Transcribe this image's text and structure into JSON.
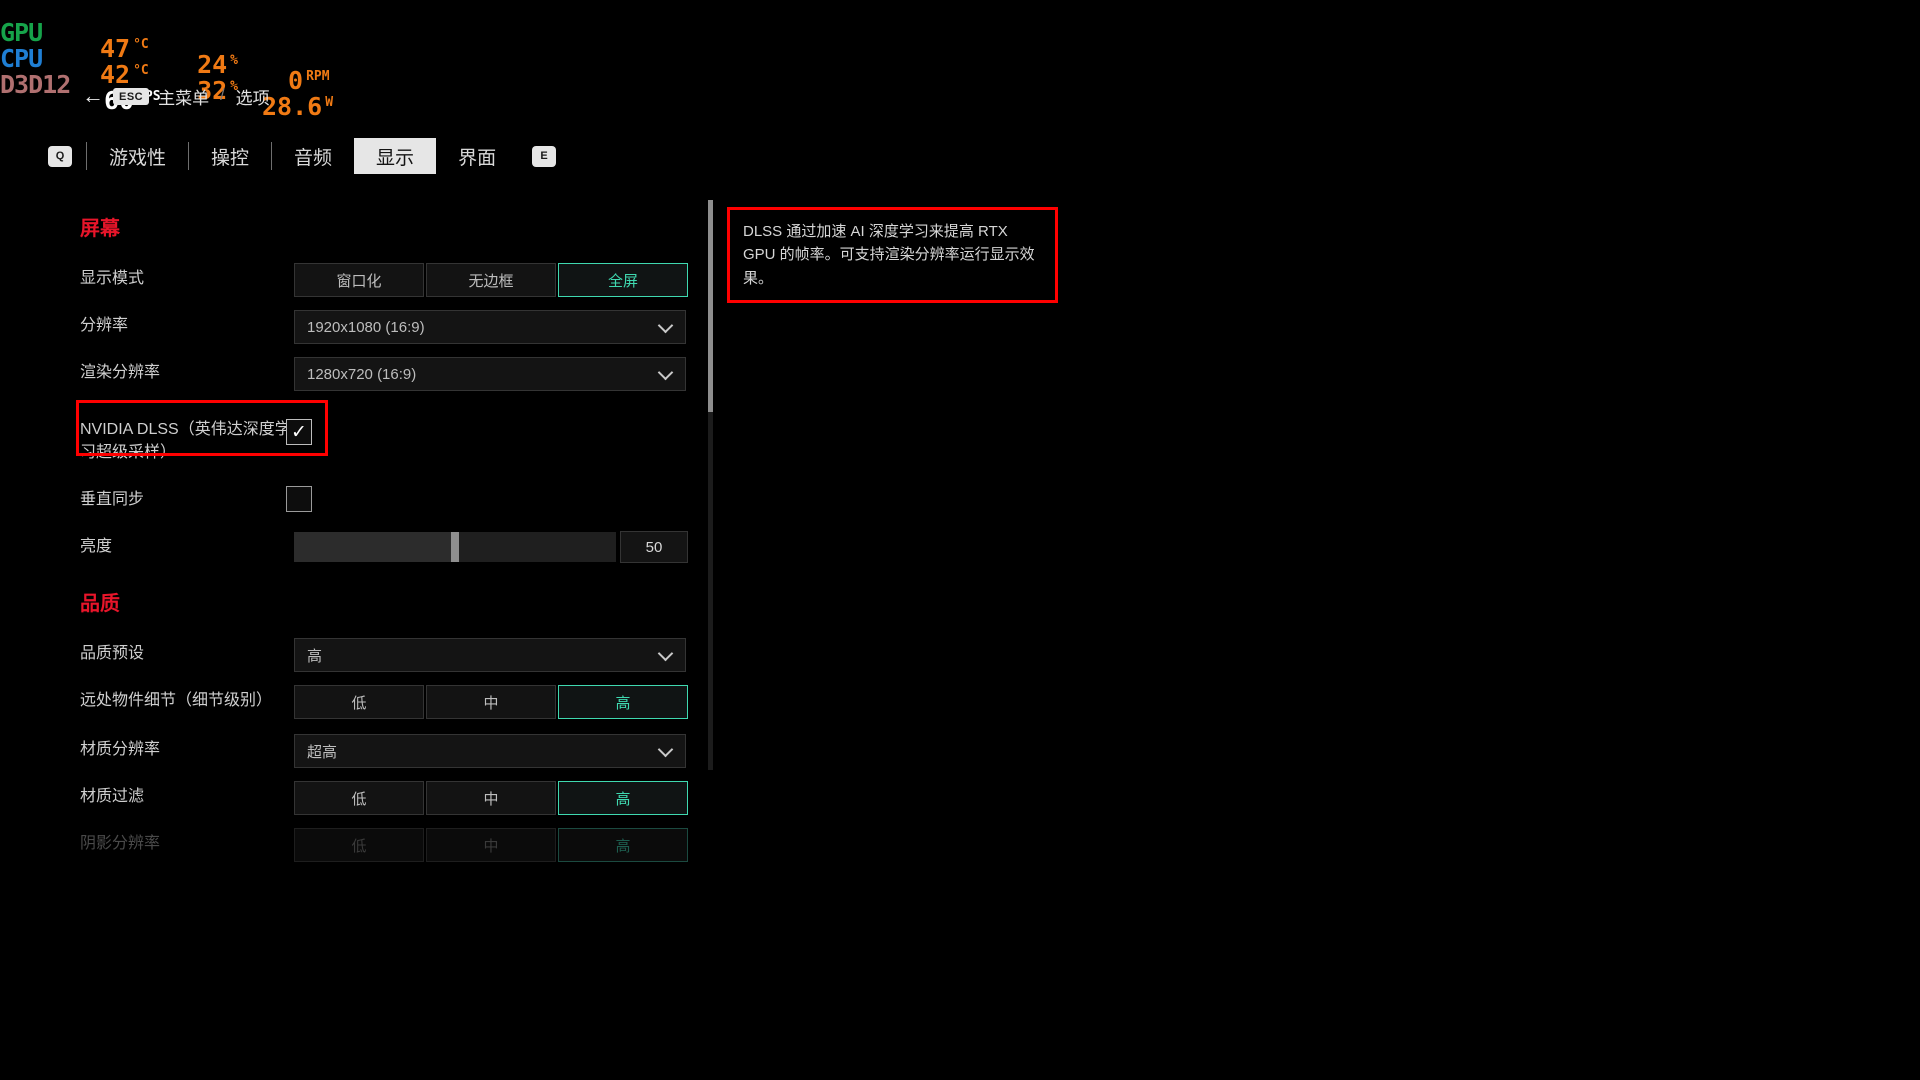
{
  "overlay": {
    "rows": [
      {
        "label": "GPU",
        "color": "#16a34a",
        "metrics": [
          {
            "value": "47",
            "unit": "°C"
          },
          {
            "value": "24",
            "unit": "%"
          },
          {
            "value": "0",
            "unit": "RPM"
          }
        ]
      },
      {
        "label": "CPU",
        "color": "#1f7fd4",
        "metrics": [
          {
            "value": "42",
            "unit": "°C"
          },
          {
            "value": "32",
            "unit": "%"
          },
          {
            "value": "28.6",
            "unit": "W"
          }
        ]
      },
      {
        "label": "D3D12",
        "color": "#b07070",
        "metrics": [
          {
            "value": "60",
            "unit": "FPS"
          }
        ]
      }
    ]
  },
  "breadcrumb": {
    "back_icon": "left-arrow-icon",
    "esc_key": "ESC",
    "root": "主菜单",
    "separator": "/",
    "current": "选项"
  },
  "tabs": {
    "prev_key": "Q",
    "next_key": "E",
    "items": [
      {
        "label": "游戏性",
        "active": false
      },
      {
        "label": "操控",
        "active": false
      },
      {
        "label": "音频",
        "active": false
      },
      {
        "label": "显示",
        "active": true
      },
      {
        "label": "界面",
        "active": false
      }
    ]
  },
  "sections": [
    {
      "title": "屏幕",
      "rows": [
        {
          "label": "显示模式",
          "type": "segmented",
          "options": [
            "窗口化",
            "无边框",
            "全屏"
          ],
          "selected_index": 2
        },
        {
          "label": "分辨率",
          "type": "dropdown",
          "value": "1920x1080 (16:9)"
        },
        {
          "label": "渲染分辨率",
          "type": "dropdown",
          "value": "1280x720 (16:9)"
        },
        {
          "label": "NVIDIA DLSS（英伟达深度学习超级采样）",
          "type": "checkbox",
          "checked": true,
          "highlighted": true
        },
        {
          "label": "垂直同步",
          "type": "checkbox",
          "checked": false
        },
        {
          "label": "亮度",
          "type": "slider",
          "value": "50",
          "percent": 50
        }
      ]
    },
    {
      "title": "品质",
      "rows": [
        {
          "label": "品质预设",
          "type": "dropdown",
          "value": "高"
        },
        {
          "label": "远处物件细节（细节级别）",
          "type": "segmented",
          "options": [
            "低",
            "中",
            "高"
          ],
          "selected_index": 2
        },
        {
          "label": "材质分辨率",
          "type": "dropdown",
          "value": "超高"
        },
        {
          "label": "材质过滤",
          "type": "segmented",
          "options": [
            "低",
            "中",
            "高"
          ],
          "selected_index": 2
        },
        {
          "label": "阴影分辨率",
          "type": "segmented",
          "options": [
            "低",
            "中",
            "高"
          ],
          "selected_index": 2,
          "disabled": true
        }
      ]
    }
  ],
  "tooltip": {
    "text": "DLSS 通过加速 AI 深度学习来提高 RTX GPU 的帧率。可支持渲染分辨率运行显示效果。"
  },
  "colors": {
    "section_red": "#e8152a",
    "selected_teal": "#3fd9b0",
    "annotation_red": "#ff0000",
    "overlay_orange": "#f07a14"
  }
}
